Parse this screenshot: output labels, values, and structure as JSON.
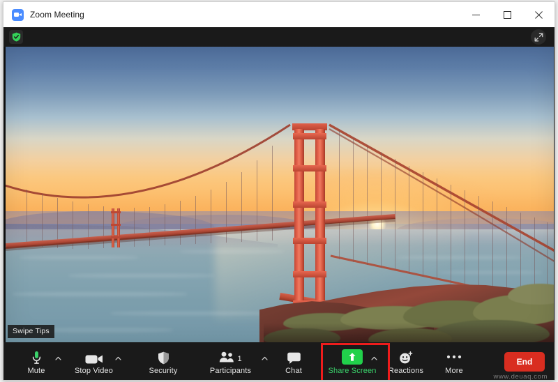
{
  "window": {
    "title": "Zoom Meeting",
    "app_icon": "zoom-logo-icon",
    "controls": {
      "minimize": "minimize-icon",
      "maximize": "maximize-icon",
      "close": "close-icon"
    }
  },
  "stage": {
    "security_badge": "shield-check-icon",
    "expand_button": "expand-fullscreen-icon",
    "swipe_tips_label": "Swipe Tips",
    "video_content": "Golden Gate Bridge at sunset with rocky coastal cliff in foreground"
  },
  "toolbar": {
    "items": [
      {
        "id": "mute",
        "label": "Mute",
        "icon": "microphone-icon",
        "has_caret": true,
        "accent": "#3ad06a"
      },
      {
        "id": "video",
        "label": "Stop Video",
        "icon": "video-camera-icon",
        "has_caret": true,
        "accent": "#e2e2e2"
      },
      {
        "id": "security",
        "label": "Security",
        "icon": "shield-icon",
        "has_caret": false,
        "accent": "#e2e2e2"
      },
      {
        "id": "participants",
        "label": "Participants",
        "icon": "people-icon",
        "has_caret": true,
        "accent": "#e2e2e2",
        "count": "1"
      },
      {
        "id": "chat",
        "label": "Chat",
        "icon": "chat-bubble-icon",
        "has_caret": false,
        "accent": "#e2e2e2"
      },
      {
        "id": "share",
        "label": "Share Screen",
        "icon": "share-arrow-up-icon",
        "has_caret": true,
        "accent": "#3ad06a",
        "highlighted": true
      },
      {
        "id": "reactions",
        "label": "Reactions",
        "icon": "smiley-plus-icon",
        "has_caret": false,
        "accent": "#e2e2e2"
      },
      {
        "id": "more",
        "label": "More",
        "icon": "ellipsis-icon",
        "has_caret": false,
        "accent": "#e2e2e2"
      }
    ],
    "end_button": {
      "label": "End",
      "color": "#d92d20"
    }
  },
  "annotation": {
    "target": "Share Screen",
    "box_color": "#ee1c1c"
  },
  "watermark": "www.deuaq.com",
  "colors": {
    "titlebar_bg": "#ffffff",
    "toolbar_bg": "#1a1a1a",
    "stage_bg": "#0e0e0e",
    "share_green": "#21d14b",
    "end_red": "#d92d20",
    "bridge_orange": "#c1432e"
  }
}
